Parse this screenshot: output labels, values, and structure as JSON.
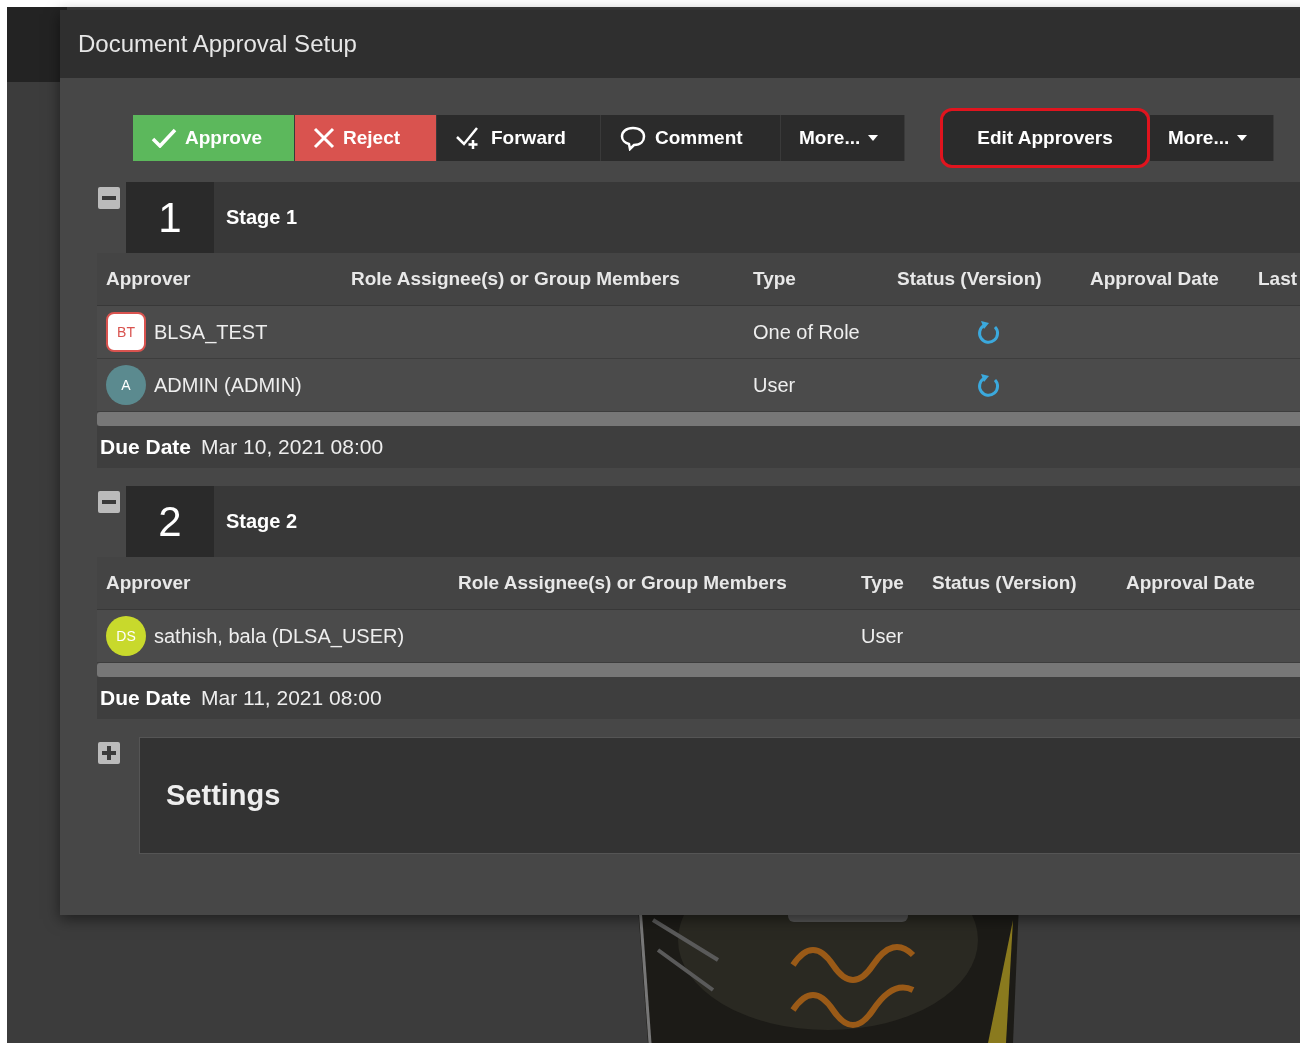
{
  "dialog": {
    "title": "Document Approval Setup"
  },
  "toolbar": {
    "actions": [
      {
        "label": "Approve",
        "kind": "approve"
      },
      {
        "label": "Reject",
        "kind": "reject"
      },
      {
        "label": "Forward",
        "kind": "forward"
      },
      {
        "label": "Comment",
        "kind": "comment"
      },
      {
        "label": "More...",
        "kind": "menu"
      }
    ],
    "edit_actions": [
      {
        "label": "Edit Approvers",
        "kind": "highlighted"
      },
      {
        "label": "More...",
        "kind": "menu"
      }
    ]
  },
  "stages": [
    {
      "number": "1",
      "name": "Stage 1",
      "expanded": true,
      "columns": [
        "Approver",
        "Role Assignee(s) or Group Members",
        "Type",
        "Status (Version)",
        "Approval Date",
        "Last"
      ],
      "rows": [
        {
          "initials": "BT",
          "kind": "square",
          "color": "#d9534f",
          "approver": "BLSA_TEST",
          "type": "One of Role",
          "in_progress": true
        },
        {
          "initials": "A",
          "kind": "circle",
          "color": "#5b8a8f",
          "approver": "ADMIN (ADMIN)",
          "type": "User",
          "in_progress": true
        }
      ],
      "due_label": "Due Date",
      "due_date": "Mar 10, 2021 08:00"
    },
    {
      "number": "2",
      "name": "Stage 2",
      "expanded": true,
      "columns": [
        "Approver",
        "Role Assignee(s) or Group Members",
        "Type",
        "Status (Version)",
        "Approval Date"
      ],
      "rows": [
        {
          "initials": "DS",
          "kind": "circle",
          "color": "#c8d92c",
          "approver": "sathish, bala (DLSA_USER)",
          "type": "User",
          "in_progress": false
        }
      ],
      "due_label": "Due Date",
      "due_date": "Mar 11, 2021 08:00"
    }
  ],
  "settings": {
    "title": "Settings",
    "expanded": false
  }
}
